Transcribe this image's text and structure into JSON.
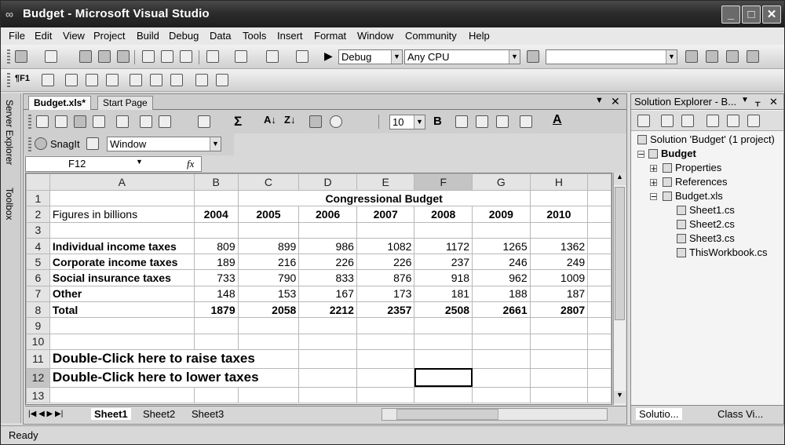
{
  "window": {
    "title": "Budget - Microsoft Visual Studio"
  },
  "menu": [
    "File",
    "Edit",
    "View",
    "Project",
    "Build",
    "Debug",
    "Data",
    "Tools",
    "Insert",
    "Format",
    "Window",
    "Community",
    "Help"
  ],
  "toolbar": {
    "config": "Debug",
    "platform": "Any CPU",
    "search": "",
    "font_size": "10",
    "font_bold": "B"
  },
  "snagit": {
    "label": "SnagIt",
    "window": "Window"
  },
  "tabs": [
    "Budget.xls*",
    "Start Page"
  ],
  "namebox": "F12",
  "fx": "fx",
  "columns": [
    "A",
    "B",
    "C",
    "D",
    "E",
    "F",
    "G",
    "H"
  ],
  "rows": [
    "1",
    "2",
    "3",
    "4",
    "5",
    "6",
    "7",
    "8",
    "9",
    "10",
    "11",
    "12",
    "13"
  ],
  "sheet": {
    "title": "Congressional Budget",
    "subtitle": "Figures in billions",
    "years": [
      "2004",
      "2005",
      "2006",
      "2007",
      "2008",
      "2009",
      "2010"
    ],
    "data": [
      {
        "label": "Individual income taxes",
        "values": [
          "809",
          "899",
          "986",
          "1082",
          "1172",
          "1265",
          "1362"
        ]
      },
      {
        "label": "Corporate income taxes",
        "values": [
          "189",
          "216",
          "226",
          "226",
          "237",
          "246",
          "249"
        ]
      },
      {
        "label": "Social insurance taxes",
        "values": [
          "733",
          "790",
          "833",
          "876",
          "918",
          "962",
          "1009"
        ]
      },
      {
        "label": "Other",
        "values": [
          "148",
          "153",
          "167",
          "173",
          "181",
          "188",
          "187"
        ]
      },
      {
        "label": "Total",
        "values": [
          "1879",
          "2058",
          "2212",
          "2357",
          "2508",
          "2661",
          "2807"
        ]
      }
    ],
    "raise": "Double-Click here to raise taxes",
    "lower": "Double-Click here to lower taxes"
  },
  "sheet_tabs": [
    "Sheet1",
    "Sheet2",
    "Sheet3"
  ],
  "left_tabs": [
    "Server Explorer",
    "Toolbox"
  ],
  "solution_explorer": {
    "title": "Solution Explorer - B...",
    "solution": "Solution 'Budget' (1 project)",
    "project": "Budget",
    "items": [
      "Properties",
      "References",
      "Budget.xls",
      "Sheet1.cs",
      "Sheet2.cs",
      "Sheet3.cs",
      "ThisWorkbook.cs"
    ],
    "bottom_tabs": [
      "Solutio...",
      "Class Vi..."
    ]
  },
  "status": "Ready"
}
